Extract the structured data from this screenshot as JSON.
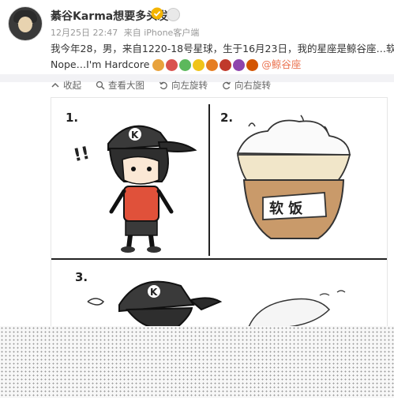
{
  "post": {
    "user_name": "綦谷Karma想要多头发",
    "timestamp": "12月25日 22:47",
    "source": "来自 iPhone客户端",
    "text_line1": "我今年28，男，来自1220-18号星球，生于16月23日，我的星座是鲸谷座…软?",
    "text_line2": "Nope…I'm Hardcore",
    "mention": "@鲸谷座"
  },
  "toolbar": {
    "collapse": "收起",
    "view_large": "查看大图",
    "rotate_left": "向左旋转",
    "rotate_right": "向右旋转"
  },
  "comic": {
    "panel1_number": "1.",
    "panel2_number": "2.",
    "panel3_number": "3.",
    "cap_letter": "K",
    "exclaim": "!!",
    "bowl_label": "软 饭"
  },
  "colors": {
    "accent": "#eb7350",
    "shirt": "#e0513a",
    "bowl": "#c99a6a",
    "verified": "#f4b400"
  }
}
